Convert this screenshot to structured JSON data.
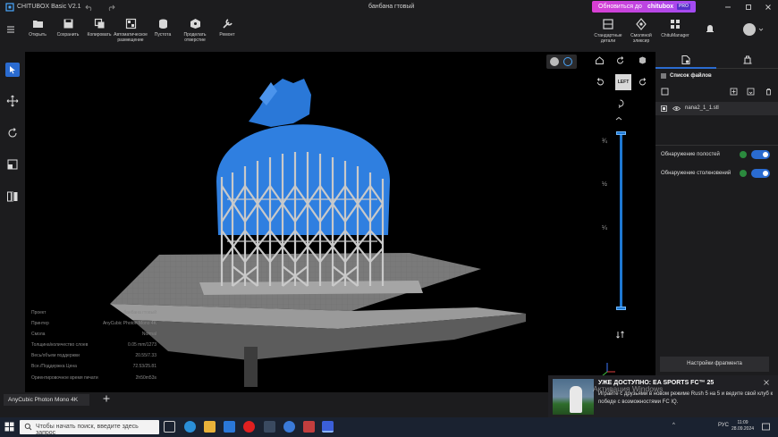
{
  "titlebar": {
    "app_name": "CHITUBOX Basic V2.1",
    "document_name": "банбана гтовый",
    "update_label": "Обновиться до",
    "update_brand": "chitubox",
    "update_badge": "PRO"
  },
  "toolbar": {
    "items": [
      {
        "label": "Открыть",
        "icon": "folder-open-icon"
      },
      {
        "label": "Сохранить",
        "icon": "save-icon"
      },
      {
        "label": "Копировать",
        "icon": "copy-icon"
      },
      {
        "label": "Автоматическое размещение",
        "icon": "auto-layout-icon"
      },
      {
        "label": "Пустота",
        "icon": "hollow-icon"
      },
      {
        "label": "Проделать отверстие",
        "icon": "punch-hole-icon"
      },
      {
        "label": "Ремонт",
        "icon": "repair-icon"
      }
    ],
    "right_items": [
      {
        "label": "Стандартные детали",
        "icon": "parts-icon"
      },
      {
        "label": "Смоляной эликсир",
        "icon": "resin-icon"
      },
      {
        "label": "ChituManager",
        "icon": "manager-icon"
      }
    ]
  },
  "viewport": {
    "cube_face": "LEFT",
    "layer_marks": [
      "¾",
      "½",
      "¼"
    ],
    "info": [
      {
        "key": "Проект",
        "value": "банбана гтовый"
      },
      {
        "key": "Принтер",
        "value": "AnyCubic Photon Mono 4K"
      },
      {
        "key": "Смола",
        "value": "Normal"
      },
      {
        "key": "Толщина/количество слоев",
        "value": "0.05 mm/1273"
      },
      {
        "key": "Весь/объем поддержки",
        "value": "20.55/7.33"
      },
      {
        "key": "Все./Поддержка Цена",
        "value": "72.53/25.81"
      },
      {
        "key": "Ориентировочное время печати",
        "value": "2h50m53s"
      }
    ]
  },
  "right_panel": {
    "title": "Список файлов",
    "files": [
      {
        "name": "nana2_1_1.stl"
      }
    ],
    "toggles": [
      {
        "label": "Обнаружение полостей",
        "on": true
      },
      {
        "label": "Обнаружение столкновений",
        "on": true
      }
    ],
    "fragment_settings": "Настройки фрагмента"
  },
  "bottom": {
    "printer_tab": "AnyCubic Photon Mono 4K",
    "add_tab": "+"
  },
  "toast": {
    "title": "УЖЕ ДОСТУПНО: EA SPORTS FC™ 25",
    "body": "Играйте с друзьями в новом режиме Rush 5 на 5 и ведите свой клуб к победе с возможностями FC IQ.",
    "watermark": "Активация Windows"
  },
  "taskbar": {
    "search_placeholder": "Чтобы начать поиск, введите здесь запрос",
    "language": "РУС",
    "time": "11:09",
    "date": "28.09.2024"
  },
  "colors": {
    "accent": "#2a6bd0",
    "model_blue": "#2f7fe0",
    "support_gray": "#c9c9c9",
    "panel": "#1c1c1e"
  }
}
